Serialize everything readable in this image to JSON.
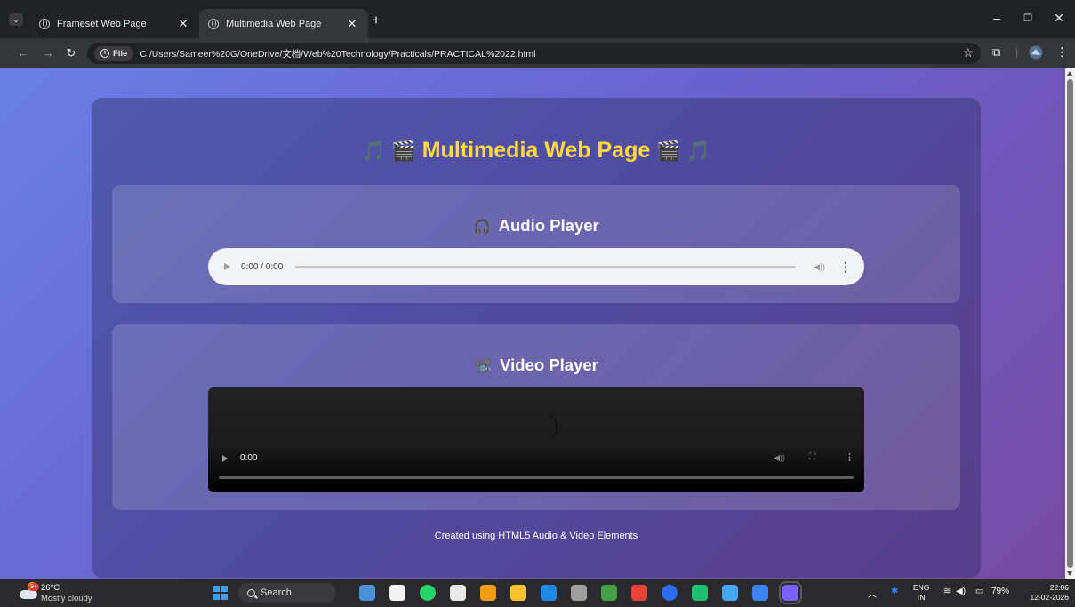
{
  "browser": {
    "tabs": [
      {
        "title": "Frameset Web Page",
        "active": false
      },
      {
        "title": "Multimedia Web Page",
        "active": true
      }
    ],
    "new_tab_label": "+",
    "address": {
      "chip_label": "File",
      "url": "C:/Users/Sameer%20G/OneDrive/文档/Web%20Technology/Practicals/PRACTICAL%2022.html"
    }
  },
  "page": {
    "title_left_emoji": "🎵 🎬",
    "title": "Multimedia Web Page",
    "title_right_emoji": "🎬 🎵",
    "audio_section": {
      "icon": "🎧",
      "heading": "Audio Player",
      "time": "0:00 / 0:00"
    },
    "video_section": {
      "icon": "📽️",
      "heading": "Video Player",
      "time": "0:00"
    },
    "footer": "Created using HTML5 Audio & Video Elements"
  },
  "taskbar": {
    "weather": {
      "badge": "9+",
      "temperature": "26°C",
      "description": "Mostly cloudy"
    },
    "search_label": "Search",
    "tray": {
      "language_top": "ENG",
      "language_bottom": "IN",
      "battery": "79%",
      "time": "22:06",
      "date": "12-02-2026"
    },
    "app_icon_colors": [
      "#4a90d9",
      "#f2f2f2",
      "#25d366",
      "#e8e8e8",
      "#f39c12",
      "#fbc02d",
      "#1e88e5",
      "#9e9e9e",
      "#43a047",
      "#ea4335",
      "#2c6df5",
      "#1dbf73",
      "#42a5f5",
      "#3b82f6",
      "#7b61ff"
    ]
  },
  "colors": {
    "title": "#ffd93d",
    "page_gradient_start": "#6a7fe6",
    "page_gradient_end": "#764ba2"
  }
}
